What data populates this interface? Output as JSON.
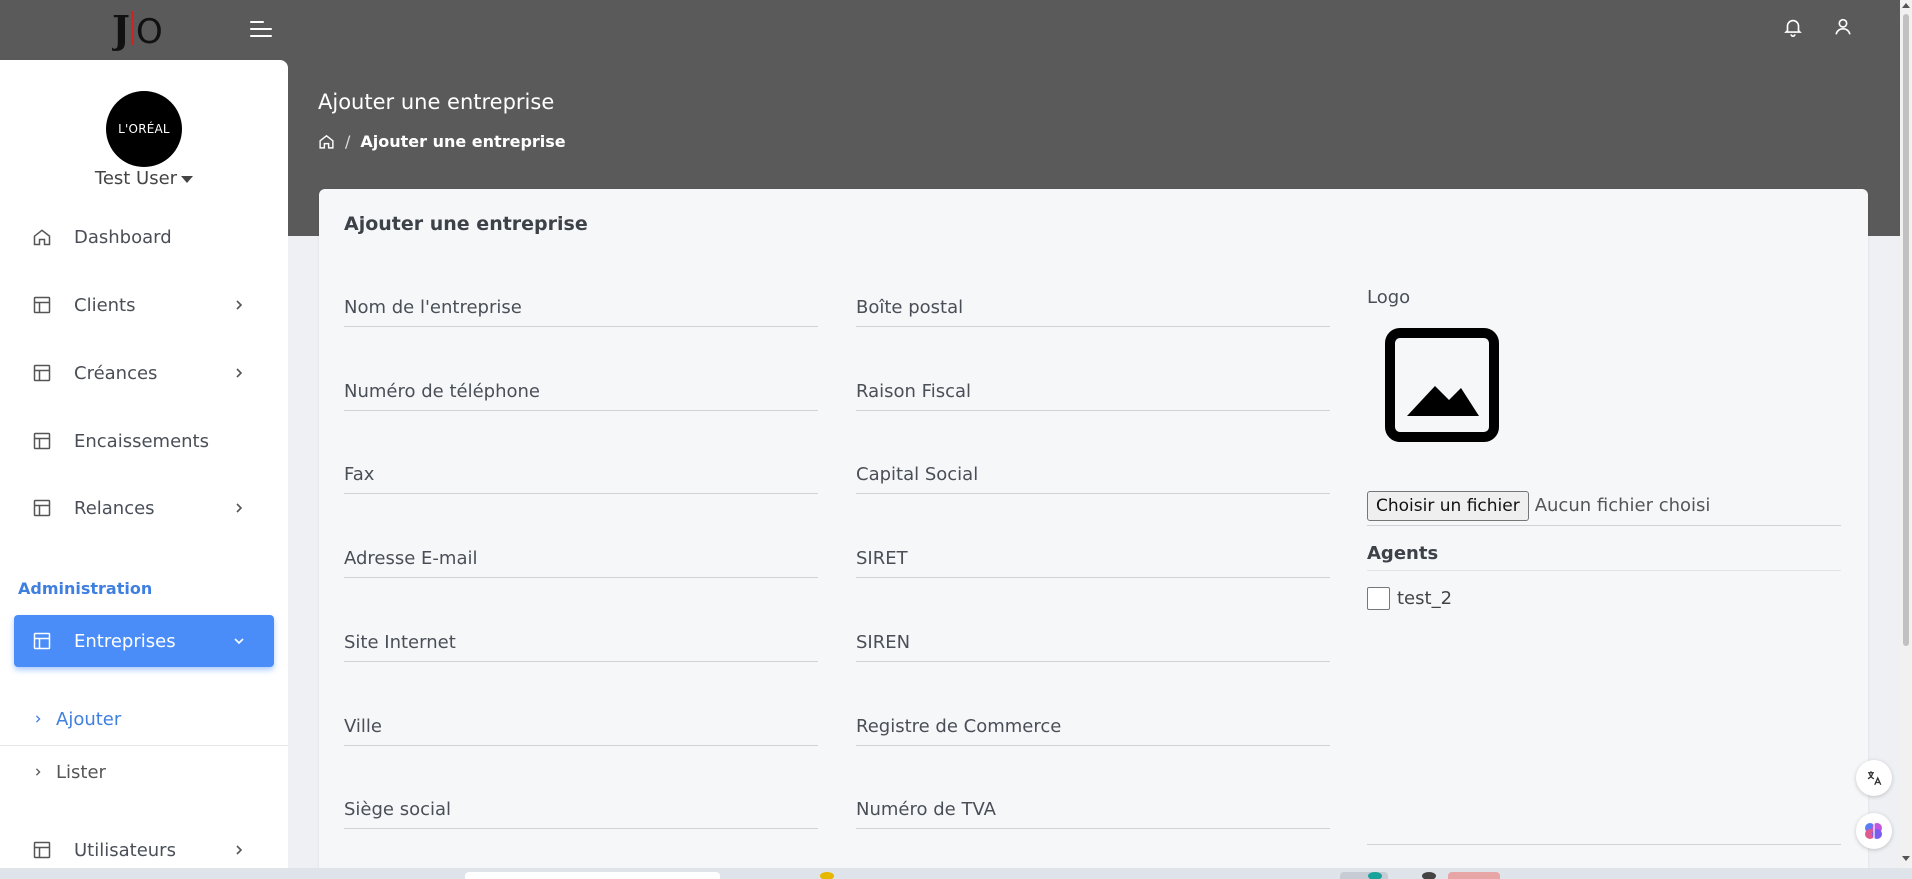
{
  "header": {
    "logo_text": "jIO",
    "menu_icon": "hamburger-menu-icon",
    "notification_icon": "bell-icon",
    "profile_icon": "user-icon"
  },
  "sidebar": {
    "company_logo_text": "L'ORÉAL",
    "user_name": "Test User",
    "items": [
      {
        "label": "Dashboard",
        "icon": "home-icon"
      },
      {
        "label": "Clients",
        "icon": "table-icon"
      },
      {
        "label": "Créances",
        "icon": "table-icon"
      },
      {
        "label": "Encaissements",
        "icon": "table-icon"
      },
      {
        "label": "Relances",
        "icon": "table-icon"
      }
    ],
    "section_label": "Administration",
    "active_item": {
      "label": "Entreprises",
      "icon": "table-icon"
    },
    "sub_items": [
      {
        "label": "Ajouter"
      },
      {
        "label": "Lister"
      }
    ],
    "bottom_item": {
      "label": "Utilisateurs",
      "icon": "table-icon"
    }
  },
  "page": {
    "title": "Ajouter une entreprise",
    "breadcrumb_current": "Ajouter une entreprise"
  },
  "form": {
    "card_title": "Ajouter une entreprise",
    "left_fields": [
      "Nom de l'entreprise",
      "Numéro de téléphone",
      "Fax",
      "Adresse E-mail",
      "Site Internet",
      "Ville",
      "Siège social"
    ],
    "middle_fields": [
      "Boîte postal",
      "Raison Fiscal",
      "Capital Social",
      "SIRET",
      "SIREN",
      "Registre de Commerce",
      "Numéro de TVA"
    ],
    "logo_label": "Logo",
    "file_button": "Choisir un fichier",
    "file_status": "Aucun fichier choisi",
    "agents_label": "Agents",
    "agents": [
      {
        "name": "test_2",
        "checked": false
      }
    ]
  },
  "colors": {
    "header_bg": "#5a5a5a",
    "accent": "#4b8df8",
    "section_label": "#3f7fe0"
  }
}
